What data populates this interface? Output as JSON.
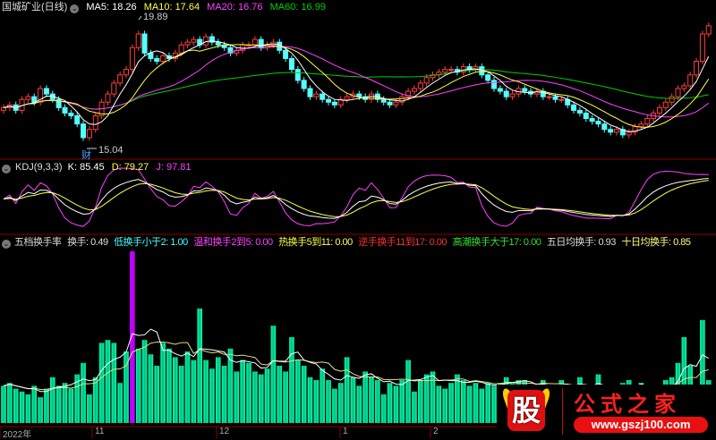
{
  "price_panel": {
    "stock_name": "国城矿业(日线)",
    "ma5": "MA5: 18.26",
    "ma10": "MA10: 17.64",
    "ma20": "MA20: 16.76",
    "ma60": "MA60: 16.99",
    "high_label": "19.89",
    "low_label": "15.04",
    "finance_mark": "财",
    "colors": {
      "up": "#ff3c3c",
      "down": "#54ffff",
      "ma5": "#ffffff",
      "ma10": "#ffff40",
      "ma20": "#ff40ff",
      "ma60": "#00d000"
    },
    "closes": [
      16.6,
      16.7,
      16.5,
      16.9,
      17.0,
      16.8,
      17.3,
      17.1,
      16.9,
      16.6,
      16.4,
      16.3,
      16.0,
      15.5,
      15.8,
      16.3,
      16.8,
      17.1,
      17.5,
      17.8,
      18.0,
      18.8,
      19.3,
      18.6,
      18.4,
      18.3,
      18.5,
      18.4,
      18.6,
      18.9,
      19.0,
      19.1,
      18.9,
      19.2,
      19.0,
      18.9,
      18.8,
      18.6,
      18.7,
      18.9,
      18.9,
      19.1,
      18.8,
      18.9,
      19.0,
      18.7,
      18.4,
      18.0,
      17.6,
      17.3,
      17.0,
      17.1,
      16.9,
      16.8,
      16.7,
      16.9,
      17.0,
      17.1,
      17.0,
      16.9,
      17.1,
      16.9,
      16.8,
      16.7,
      16.8,
      17.0,
      17.2,
      17.3,
      17.5,
      17.7,
      17.8,
      17.9,
      18.0,
      18.0,
      17.9,
      18.1,
      18.0,
      18.1,
      17.8,
      17.6,
      17.3,
      17.2,
      17.0,
      17.1,
      17.3,
      17.2,
      17.1,
      17.2,
      17.0,
      17.0,
      16.9,
      16.9,
      16.7,
      16.5,
      16.4,
      16.2,
      16.1,
      16.0,
      15.8,
      15.7,
      15.8,
      15.6,
      15.7,
      15.9,
      16.0,
      16.2,
      16.4,
      16.6,
      16.8,
      17.0,
      17.3,
      17.4,
      17.8,
      18.3,
      19.3,
      19.6
    ]
  },
  "kdj_panel": {
    "title": "KDJ(9,3,3)",
    "k": "K: 85.45",
    "d": "D: 79.27",
    "j": "J: 97.81"
  },
  "turnover_panel": {
    "title": "五档换手率",
    "turnover": "换手: 0.49",
    "low": "低换手小于2: 1.00",
    "mild": "温和换手2到5: 0.00",
    "hot": "热换手5到11: 0.00",
    "heavy": "逆手换手11到17: 0.00",
    "climax": "高潮换手大于17: 0.00",
    "avg5": "五日均换手: 0.93",
    "avg10": "十日均换手: 0.85",
    "highlight_index": 21,
    "values": [
      1.3,
      1.4,
      1.2,
      1.1,
      1.0,
      1.3,
      0.9,
      1.2,
      1.6,
      1.3,
      1.4,
      1.2,
      1.7,
      2.1,
      1.0,
      1.6,
      2.8,
      2.9,
      2.8,
      1.4,
      2.5,
      6.0,
      2.6,
      2.9,
      2.4,
      2.0,
      2.8,
      2.6,
      2.3,
      2.0,
      2.5,
      2.2,
      4.0,
      2.2,
      1.9,
      2.3,
      2.0,
      2.6,
      1.8,
      2.2,
      2.1,
      1.8,
      1.7,
      1.9,
      3.4,
      2.0,
      1.8,
      3.0,
      2.2,
      2.0,
      1.6,
      1.5,
      1.9,
      1.5,
      1.2,
      1.4,
      2.3,
      1.6,
      1.3,
      1.8,
      1.6,
      1.5,
      1.0,
      1.4,
      1.3,
      1.5,
      2.2,
      1.1,
      1.5,
      1.7,
      1.8,
      1.3,
      1.2,
      1.4,
      1.7,
      1.5,
      1.3,
      1.4,
      1.2,
      1.4,
      1.3,
      1.4,
      1.6,
      1.4,
      1.5,
      1.5,
      1.2,
      1.1,
      1.5,
      1.3,
      1.2,
      1.5,
      1.3,
      1.2,
      1.6,
      1.1,
      1.3,
      1.7,
      0.9,
      1.0,
      1.3,
      1.4,
      1.5,
      1.2,
      1.4,
      1.0,
      0.8,
      1.3,
      1.5,
      1.6,
      2.1,
      3.0,
      2.0,
      1.2,
      3.6,
      1.5
    ]
  },
  "x_axis": {
    "labels": [
      "2022年",
      "11",
      "12",
      "1",
      "2"
    ]
  },
  "watermark": {
    "glyph": "股",
    "title": "公式之家",
    "url": "www.gszj100.com"
  }
}
